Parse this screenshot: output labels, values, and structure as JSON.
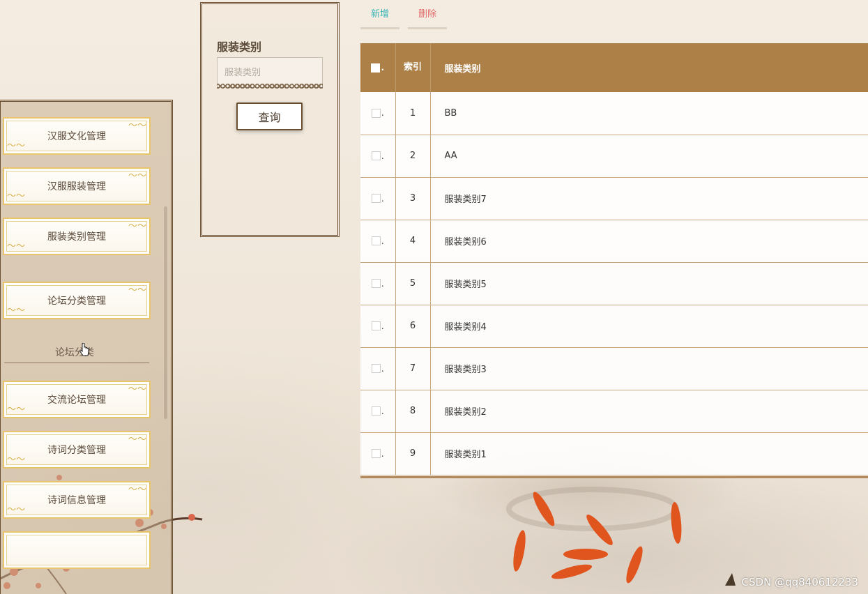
{
  "sidebar": {
    "items": [
      {
        "label": "汉服文化管理"
      },
      {
        "label": "汉服服装管理"
      },
      {
        "label": "服装类别管理"
      },
      {
        "label": "论坛分类管理"
      },
      {
        "label": "交流论坛管理"
      },
      {
        "label": "诗词分类管理"
      },
      {
        "label": "诗词信息管理"
      }
    ],
    "submenu_label": "论坛分类"
  },
  "search": {
    "label": "服装类别",
    "placeholder": "服装类别",
    "button_label": "查询"
  },
  "toolbar": {
    "add_label": "新增",
    "delete_label": "删除"
  },
  "table": {
    "headers": {
      "index": "索引",
      "name": "服装类别"
    },
    "rows": [
      {
        "index": "1",
        "name": "BB"
      },
      {
        "index": "2",
        "name": "AA"
      },
      {
        "index": "3",
        "name": "服装类别7"
      },
      {
        "index": "4",
        "name": "服装类别6"
      },
      {
        "index": "5",
        "name": "服装类别5"
      },
      {
        "index": "6",
        "name": "服装类别4"
      },
      {
        "index": "7",
        "name": "服装类别3"
      },
      {
        "index": "8",
        "name": "服装类别2"
      },
      {
        "index": "9",
        "name": "服装类别1"
      }
    ]
  },
  "watermark": "CSDN @qq840612233",
  "colors": {
    "header_bg": "#ad8048",
    "add_text": "#38b5b8",
    "delete_text": "#e06a6a",
    "panel_border": "#6b4e2f"
  }
}
